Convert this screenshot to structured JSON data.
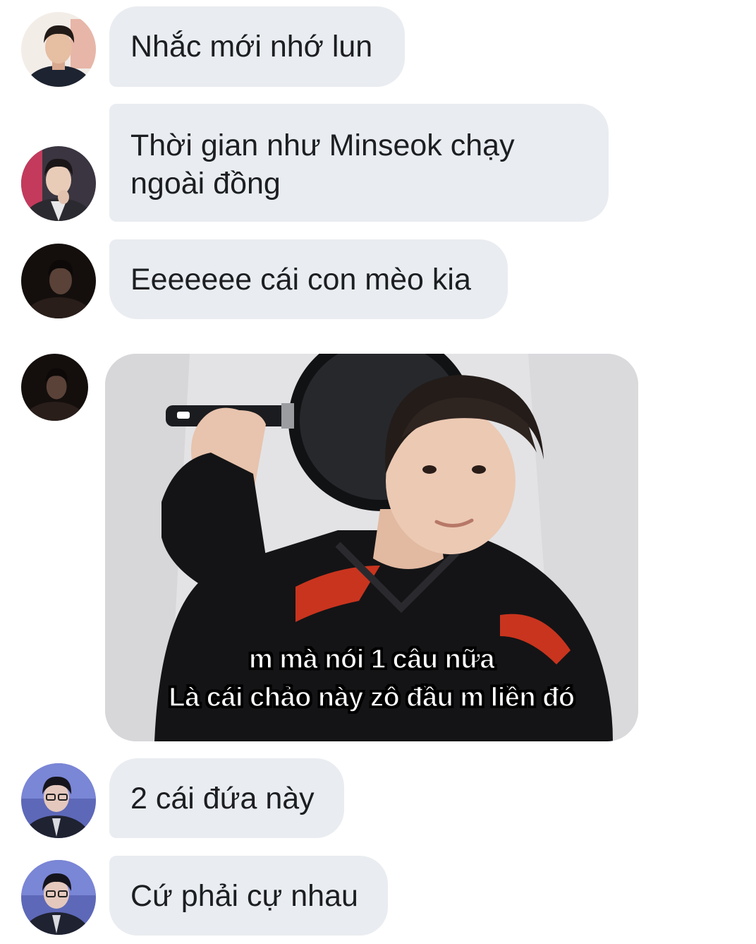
{
  "messages": [
    {
      "text": "Nhắc mới nhớ lun"
    },
    {
      "text": "Thời gian như Minseok chạy ngoài đồng"
    },
    {
      "text": "Eeeeeee cái con mèo kia"
    },
    {
      "image": {
        "caption_line1": "m mà nói 1 câu nữa",
        "caption_line2": "Là cái chảo này zô đầu m liền đó"
      }
    },
    {
      "text": "2 cái đứa này"
    },
    {
      "text": "Cứ phải cự nhau"
    }
  ],
  "colors": {
    "bubble_bg": "#e9ecf0",
    "text": "#1c1e21",
    "background": "#ffffff"
  }
}
